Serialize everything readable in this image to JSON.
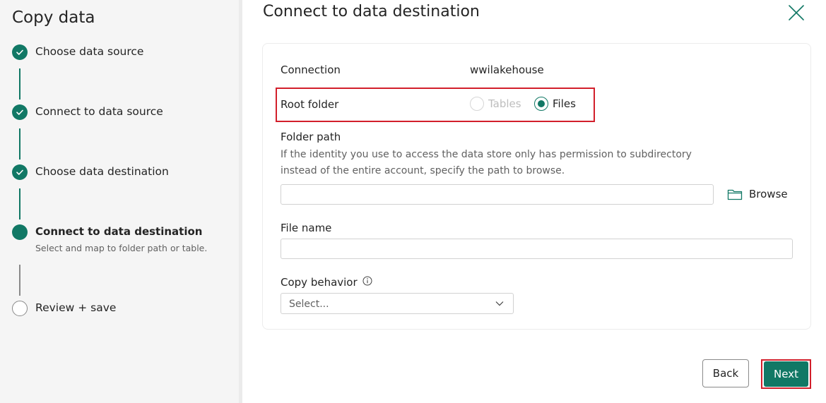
{
  "sidebar": {
    "title": "Copy data",
    "steps": [
      {
        "label": "Choose data source",
        "state": "done"
      },
      {
        "label": "Connect to data source",
        "state": "done"
      },
      {
        "label": "Choose data destination",
        "state": "done"
      },
      {
        "label": "Connect to data destination",
        "state": "current",
        "subtitle": "Select and map to folder path or table."
      },
      {
        "label": "Review + save",
        "state": "pending"
      }
    ]
  },
  "main": {
    "title": "Connect to data destination",
    "connection_label": "Connection",
    "connection_value": "wwilakehouse",
    "root_folder": {
      "label": "Root folder",
      "options": [
        {
          "label": "Tables",
          "checked": false,
          "disabled": true
        },
        {
          "label": "Files",
          "checked": true,
          "disabled": false
        }
      ]
    },
    "folder_path": {
      "label": "Folder path",
      "help_line1": "If the identity you use to access the data store only has permission to subdirectory",
      "help_line2": "instead of the entire account, specify the path to browse.",
      "value": "",
      "browse_label": "Browse"
    },
    "file_name": {
      "label": "File name",
      "value": ""
    },
    "copy_behavior": {
      "label": "Copy behavior",
      "selected": "Select..."
    }
  },
  "footer": {
    "back_label": "Back",
    "next_label": "Next"
  },
  "colors": {
    "accent": "#117865",
    "highlight": "#d21f2b"
  }
}
